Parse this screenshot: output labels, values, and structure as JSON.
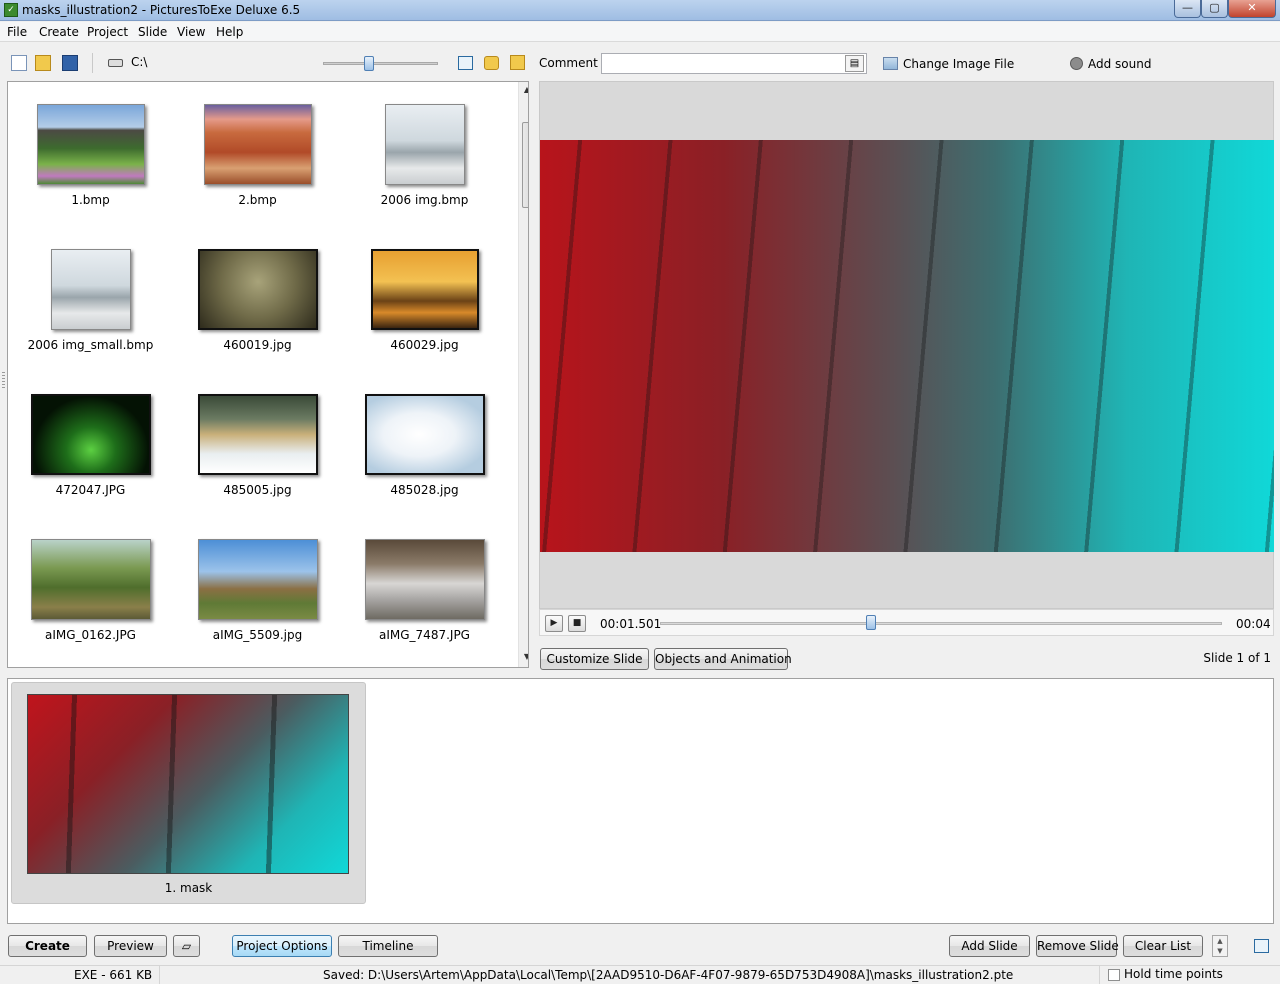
{
  "window": {
    "title": "masks_illustration2 - PicturesToExe Deluxe 6.5",
    "controls": {
      "minimize": "—",
      "maximize": "▢",
      "close": "✕"
    }
  },
  "menu": [
    "File",
    "Create",
    "Project",
    "Slide",
    "View",
    "Help"
  ],
  "toolbar": {
    "drive_path": "C:\\",
    "comment_label": "Comment",
    "comment_value": "",
    "change_image_label": "Change Image File",
    "add_sound_label": "Add sound",
    "icons": [
      "new-project-icon",
      "open-project-icon",
      "save-project-icon",
      "drive-icon",
      "fit-view-icon",
      "folder-icon",
      "folder-up-icon"
    ]
  },
  "files": [
    {
      "name": "1.bmp"
    },
    {
      "name": "2.bmp"
    },
    {
      "name": "2006 img.bmp"
    },
    {
      "name": "2006 img_small.bmp"
    },
    {
      "name": "460019.jpg"
    },
    {
      "name": "460029.jpg"
    },
    {
      "name": "472047.JPG"
    },
    {
      "name": "485005.jpg"
    },
    {
      "name": "485028.jpg"
    },
    {
      "name": "aIMG_0162.JPG"
    },
    {
      "name": "aIMG_5509.jpg"
    },
    {
      "name": "aIMG_7487.JPG"
    }
  ],
  "player": {
    "current_time": "00:01.501",
    "total_time": "00:04",
    "position_fraction": 0.375
  },
  "preview_buttons": {
    "customize": "Customize Slide",
    "objects": "Objects and Animation"
  },
  "slide_counter": "Slide 1 of 1",
  "slides": [
    {
      "label": "1. mask"
    }
  ],
  "bottom": {
    "create": "Create",
    "preview": "Preview",
    "project_options": "Project Options",
    "timeline": "Timeline",
    "add_slide": "Add Slide",
    "remove_slide": "Remove Slide",
    "clear_list": "Clear List"
  },
  "status": {
    "exe_size": "EXE - 661 KB",
    "saved_path": "Saved: D:\\Users\\Artem\\AppData\\Local\\Temp\\[2AAD9510-D6AF-4F07-9879-65D753D4908A]\\masks_illustration2.pte",
    "hold_time_points": "Hold time points"
  },
  "colors": {
    "accent": "#3c7fb1",
    "preview_red": "#c0141c",
    "preview_cyan": "#10d8d8"
  }
}
